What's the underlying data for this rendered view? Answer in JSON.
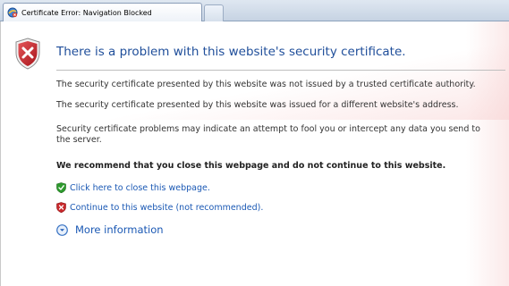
{
  "tab": {
    "title": "Certificate Error: Navigation Blocked"
  },
  "page": {
    "heading": "There is a problem with this website's security certificate.",
    "paragraphs": [
      "The security certificate presented by this website was not issued by a trusted certificate authority.",
      "The security certificate presented by this website was issued for a different website's address.",
      "Security certificate problems may indicate an attempt to fool you or intercept any data you send to the server."
    ],
    "recommendation": "We recommend that you close this webpage and do not continue to this website.",
    "close_link": "Click here to close this webpage.",
    "continue_link": "Continue to this website (not recommended).",
    "more_info": "More information"
  },
  "icons": {
    "tab": "ie-error-icon",
    "heading": "red-shield-x-icon",
    "close": "green-shield-check-icon",
    "continue": "red-shield-x-icon",
    "more": "expand-circle-icon"
  },
  "colors": {
    "heading": "#1f4e9a",
    "link": "#1a58b4",
    "shield_red": "#c8282b",
    "shield_green": "#2e9a2e"
  }
}
